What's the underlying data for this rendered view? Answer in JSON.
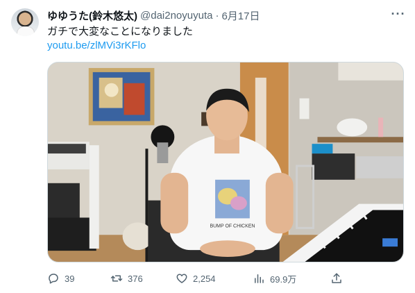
{
  "tweet": {
    "display_name": "ゆゆうた(鈴木悠太)",
    "handle": "@dai2noyuyuta",
    "separator": "·",
    "date": "6月17日",
    "text": "ガチで大変なことになりました",
    "link": "youtu.be/zlMVi3rKFlo",
    "more_icon": "more-horizontal-icon"
  },
  "media": {
    "shirt_print": "BUMP OF CHICKEN"
  },
  "actions": {
    "replies": "39",
    "retweets": "376",
    "likes": "2,254",
    "views": "69.9万"
  },
  "icons": {
    "reply": "reply-icon",
    "retweet": "retweet-icon",
    "like": "heart-icon",
    "views": "views-icon",
    "share": "share-icon"
  },
  "colors": {
    "link": "#1d9bf0",
    "secondary_text": "#536471",
    "primary_text": "#0f1419"
  }
}
